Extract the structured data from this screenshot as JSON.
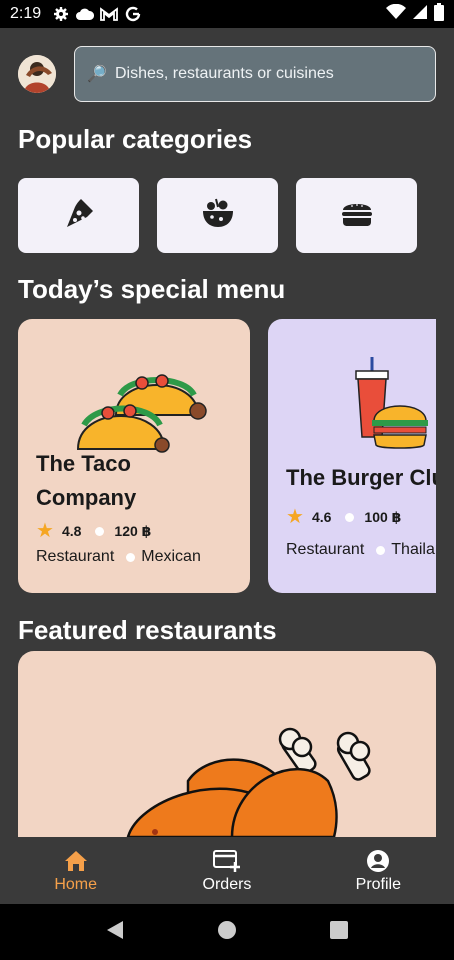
{
  "status_bar": {
    "time": "2:19",
    "left_icons": [
      "gear-icon",
      "cloud-icon",
      "gmail-icon",
      "google-icon"
    ],
    "right_icons": [
      "wifi-icon",
      "signal-icon",
      "battery-icon"
    ]
  },
  "search": {
    "placeholder": "Dishes, restaurants or cuisines"
  },
  "popular": {
    "title": "Popular categories",
    "categories": [
      {
        "icon": "pizza-icon"
      },
      {
        "icon": "salad-bowl-icon"
      },
      {
        "icon": "burger-icon"
      }
    ]
  },
  "specials": {
    "title": "Today’s special menu",
    "items": [
      {
        "name_line1": "The Taco",
        "name_line2": "Company",
        "rating": "4.8",
        "price": "120 ฿",
        "type": "Restaurant",
        "cuisine": "Mexican",
        "bg": "#f2d5c4"
      },
      {
        "name_line1": "The Burger Club",
        "rating": "4.6",
        "price": "100 ฿",
        "type": "Restaurant",
        "cuisine": "Thailand",
        "bg": "#ddd5f5"
      }
    ]
  },
  "featured": {
    "title": "Featured restaurants"
  },
  "bottom_nav": {
    "items": [
      {
        "label": "Home",
        "icon": "home-icon",
        "active": true
      },
      {
        "label": "Orders",
        "icon": "orders-icon",
        "active": false
      },
      {
        "label": "Profile",
        "icon": "profile-icon",
        "active": false
      }
    ],
    "active_color": "#f5a04a"
  },
  "system_nav": [
    "back-icon",
    "home-circle-icon",
    "recents-icon"
  ]
}
